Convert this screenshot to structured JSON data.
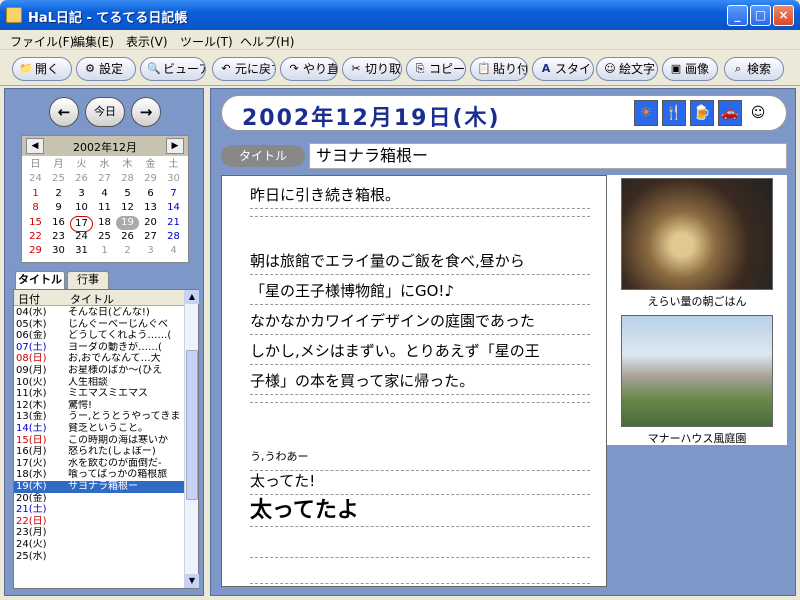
{
  "window": {
    "title": "HaL日記 - てるてる日記帳"
  },
  "menu": [
    "ファイル(F)",
    "編集(E)",
    "表示(V)",
    "ツール(T)",
    "ヘルプ(H)"
  ],
  "toolbar": [
    "開く",
    "設定",
    "ビューア",
    "元に戻す",
    "やり直し",
    "切り取り",
    "コピー",
    "貼り付け",
    "スタイル",
    "絵文字",
    "画像",
    "検索"
  ],
  "nav": {
    "today": "今日"
  },
  "calendar": {
    "month": "2002年12月",
    "weekdays": [
      "日",
      "月",
      "火",
      "水",
      "木",
      "金",
      "土"
    ],
    "weeks": [
      [
        "24",
        "25",
        "26",
        "27",
        "28",
        "29",
        "30"
      ],
      [
        "1",
        "2",
        "3",
        "4",
        "5",
        "6",
        "7"
      ],
      [
        "8",
        "9",
        "10",
        "11",
        "12",
        "13",
        "14"
      ],
      [
        "15",
        "16",
        "17",
        "18",
        "19",
        "20",
        "21"
      ],
      [
        "22",
        "23",
        "24",
        "25",
        "26",
        "27",
        "28"
      ],
      [
        "29",
        "30",
        "31",
        "1",
        "2",
        "3",
        "4"
      ]
    ]
  },
  "tabs": {
    "title": "タイトル",
    "events": "行事"
  },
  "list": {
    "col_date": "日付",
    "col_title": "タイトル",
    "rows": [
      [
        "04(水)",
        "そんな日(どんな!)"
      ],
      [
        "05(木)",
        "じんぐーべーじんぐべ"
      ],
      [
        "06(金)",
        "どうしてくれよう……("
      ],
      [
        "07(土)",
        "ヨーダの動きが……("
      ],
      [
        "08(日)",
        "お,おでんなんて…大"
      ],
      [
        "09(月)",
        "お星様のばか～(ひえ"
      ],
      [
        "10(火)",
        "人生相談"
      ],
      [
        "11(水)",
        "ミエマスミエマス"
      ],
      [
        "12(木)",
        "驚愕!"
      ],
      [
        "13(金)",
        "うー,とうとうやってきま"
      ],
      [
        "14(土)",
        "貧乏ということ。"
      ],
      [
        "15(日)",
        "この時期の海は寒いか"
      ],
      [
        "16(月)",
        "怒られた(しょぼー)"
      ],
      [
        "17(火)",
        "水を飲むのが面倒だ-"
      ],
      [
        "18(水)",
        "喰ってばっかの箱根旅"
      ],
      [
        "19(木)",
        "サヨナラ箱根ー"
      ],
      [
        "20(金)",
        ""
      ],
      [
        "21(土)",
        ""
      ],
      [
        "22(日)",
        ""
      ],
      [
        "23(月)",
        ""
      ],
      [
        "24(火)",
        ""
      ],
      [
        "25(水)",
        ""
      ]
    ]
  },
  "entry": {
    "date": "2002年12月19日(木)",
    "title_label": "タイトル",
    "title": "サヨナラ箱根ー",
    "lines": [
      "昨日に引き続き箱根。",
      "",
      "朝は旅館でエライ量のご飯を食べ,昼から",
      "「星の王子様博物館」にGO!♪",
      "なかなかカワイイデザインの庭園であった",
      "しかし,メシはまずい。とりあえず「星の王",
      "子様」の本を買って家に帰った。",
      "",
      "う,うわあー",
      "太ってた!",
      "太ってたよ"
    ],
    "captions": [
      "えらい量の朝ごはん",
      "マナーハウス風庭園"
    ]
  }
}
